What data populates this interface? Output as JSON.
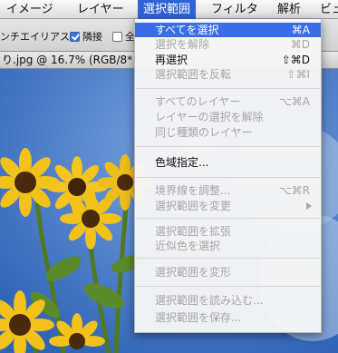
{
  "menubar": {
    "items": [
      {
        "label": "イメージ"
      },
      {
        "label": "レイヤー"
      },
      {
        "label": "選択範囲",
        "active": true
      },
      {
        "label": "フィルタ"
      },
      {
        "label": "解析"
      },
      {
        "label": "ビュ"
      }
    ]
  },
  "optionsbar": {
    "antialias_label": "ンチエイリアス",
    "contiguous_label": "隣接",
    "contiguous_checked": true,
    "all_layers_label": "全"
  },
  "document": {
    "title": "り.jpg @ 16.7% (RGB/8*"
  },
  "select_menu": {
    "items": [
      {
        "label": "すべてを選択",
        "shortcut": "⌘A",
        "state": "selected"
      },
      {
        "label": "選択を解除",
        "shortcut": "⌘D",
        "state": "disabled"
      },
      {
        "label": "再選択",
        "shortcut": "⇧⌘D",
        "state": "enabled"
      },
      {
        "label": "選択範囲を反転",
        "shortcut": "⇧⌘I",
        "state": "disabled"
      },
      {
        "label": "すべてのレイヤー",
        "shortcut": "⌥⌘A",
        "state": "disabled"
      },
      {
        "label": "レイヤーの選択を解除",
        "shortcut": "",
        "state": "disabled"
      },
      {
        "label": "同じ種類のレイヤー",
        "shortcut": "",
        "state": "disabled"
      },
      {
        "label": "色域指定...",
        "shortcut": "",
        "state": "enabled"
      },
      {
        "label": "境界線を調整...",
        "shortcut": "⌥⌘R",
        "state": "disabled"
      },
      {
        "label": "選択範囲を変更",
        "shortcut": "",
        "state": "disabled",
        "submenu": true
      },
      {
        "label": "選択範囲を拡張",
        "shortcut": "",
        "state": "disabled"
      },
      {
        "label": "近似色を選択",
        "shortcut": "",
        "state": "disabled"
      },
      {
        "label": "選択範囲を変形",
        "shortcut": "",
        "state": "disabled"
      },
      {
        "label": "選択範囲を読み込む...",
        "shortcut": "",
        "state": "disabled"
      },
      {
        "label": "選択範囲を保存...",
        "shortcut": "",
        "state": "disabled"
      }
    ]
  },
  "colors": {
    "menu_highlight": "#3a6ee6",
    "sky": "#5a8fd6",
    "petal": "#f2c21b",
    "center": "#4a2a0c"
  }
}
